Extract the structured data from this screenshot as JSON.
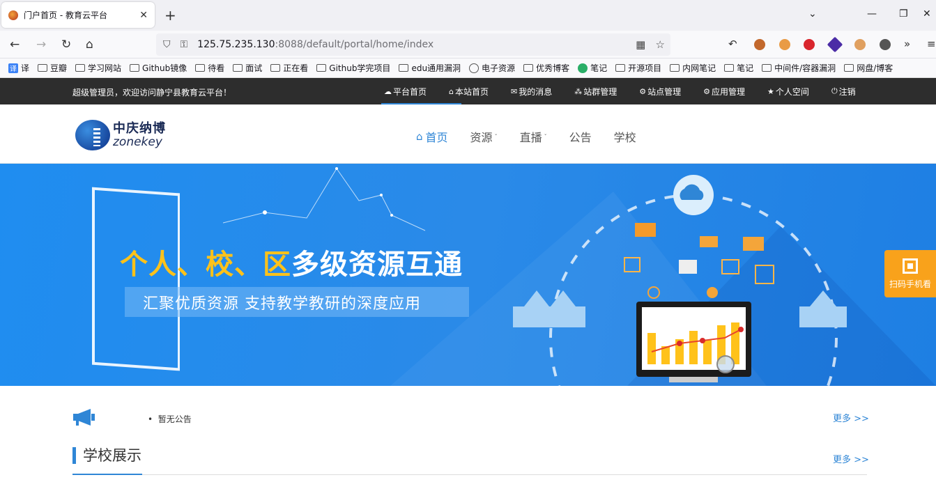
{
  "browser": {
    "tab_title": "门户首页 - 教育云平台",
    "url_host": "125.75.235.130",
    "url_rest": ":8088/default/portal/home/index",
    "bookmarks": [
      "译",
      "豆瓣",
      "学习网站",
      "Github镜像",
      "待看",
      "面试",
      "正在看",
      "Github学完项目",
      "edu通用漏洞",
      "电子资源",
      "优秀博客",
      "笔记",
      "开源项目",
      "内网笔记",
      "笔记",
      "中间件/容器漏洞",
      "网盘/博客"
    ]
  },
  "sitebar": {
    "welcome": "超级管理员，欢迎访问静宁县教育云平台！",
    "nav": [
      {
        "icon": "☁",
        "label": "平台首页"
      },
      {
        "icon": "⌂",
        "label": "本站首页"
      },
      {
        "icon": "✉",
        "label": "我的消息"
      },
      {
        "icon": "⁂",
        "label": "站群管理"
      },
      {
        "icon": "⚙",
        "label": "站点管理"
      },
      {
        "icon": "⚙",
        "label": "应用管理"
      },
      {
        "icon": "★",
        "label": "个人空间"
      },
      {
        "icon": "⏻",
        "label": "注销"
      }
    ]
  },
  "header": {
    "logo_cn": "中庆纳博",
    "logo_en": "zonekey",
    "nav": [
      {
        "label": "首页",
        "active": true
      },
      {
        "label": "资源",
        "caret": "ˇ"
      },
      {
        "label": "直播",
        "caret": "ˇ"
      },
      {
        "label": "公告"
      },
      {
        "label": "学校"
      }
    ]
  },
  "banner": {
    "headline_yellow_1": "个人、",
    "headline_yellow_2": "校、",
    "headline_yellow_3": "区",
    "headline_white": "多级资源互通",
    "subline": "汇聚优质资源 支持教学教研的深度应用"
  },
  "float": {
    "scan_label": "扫码手机看"
  },
  "content": {
    "notice_bullet": "•",
    "notice_text": "暂无公告",
    "more_1": "更多 >>",
    "section_title": "学校展示",
    "more_2": "更多 >>"
  },
  "colors": {
    "accent": "#2f86d6",
    "topbar": "#2d2d2d",
    "banner": "#1f8df0",
    "yellow": "#ffc21a",
    "scan": "#f9a21b"
  }
}
